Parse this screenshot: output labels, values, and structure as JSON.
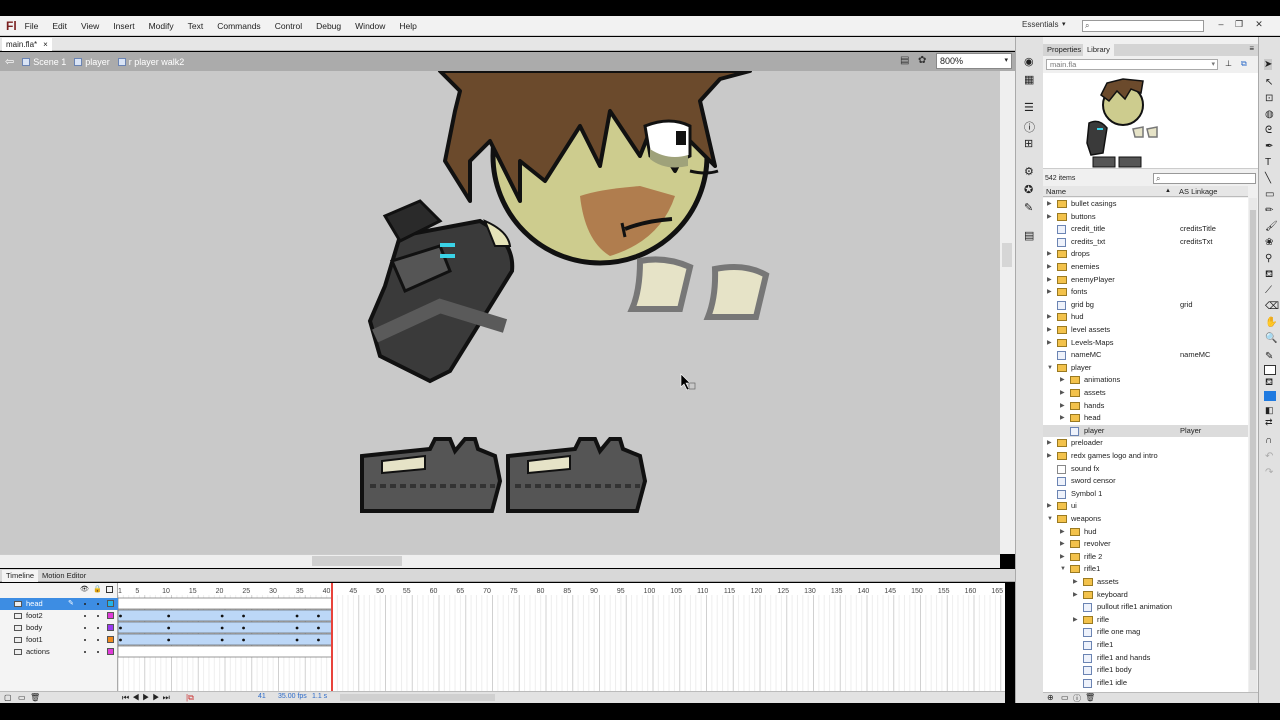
{
  "app": {
    "logo": "Fl",
    "workspace": "Essentials"
  },
  "menu": [
    "File",
    "Edit",
    "View",
    "Insert",
    "Modify",
    "Text",
    "Commands",
    "Control",
    "Debug",
    "Window",
    "Help"
  ],
  "window_buttons": [
    "–",
    "❐",
    "✕"
  ],
  "document": {
    "tab_label": "main.fla*",
    "close": "×"
  },
  "breadcrumbs": [
    "Scene 1",
    "player",
    "r player walk2"
  ],
  "zoom": "800%",
  "timeline": {
    "tabs": [
      "Timeline",
      "Motion Editor"
    ],
    "frame_numbers": [
      "1",
      "5",
      "10",
      "15",
      "20",
      "25",
      "30",
      "35",
      "40",
      "45",
      "50",
      "55",
      "60",
      "65",
      "70",
      "75",
      "80",
      "85",
      "90",
      "95",
      "100",
      "105",
      "110",
      "115",
      "120",
      "125",
      "130",
      "135",
      "140",
      "145",
      "150",
      "155",
      "160",
      "165"
    ],
    "layers": [
      {
        "name": "head",
        "color": "#22b3ea",
        "selected": true
      },
      {
        "name": "foot2",
        "color": "#e03ad8",
        "selected": false
      },
      {
        "name": "body",
        "color": "#9a3af0",
        "selected": false
      },
      {
        "name": "foot1",
        "color": "#f08a1d",
        "selected": false
      },
      {
        "name": "actions",
        "color": "#e03ad8",
        "selected": false
      }
    ],
    "current_frame": "41",
    "fps": "35.00 fps",
    "elapsed": "1.1 s"
  },
  "panel_tabs": [
    "Properties",
    "Library"
  ],
  "library": {
    "document": "main.fla",
    "item_count": "542 items",
    "columns": {
      "name": "Name",
      "linkage": "AS Linkage"
    },
    "items": [
      {
        "name": "bullet casings",
        "type": "folder",
        "indent": 0,
        "expanded": false,
        "linkage": ""
      },
      {
        "name": "buttons",
        "type": "folder",
        "indent": 0,
        "expanded": false,
        "linkage": ""
      },
      {
        "name": "credit_title",
        "type": "symbol",
        "indent": 0,
        "expanded": null,
        "linkage": "creditsTitle"
      },
      {
        "name": "credits_txt",
        "type": "symbol",
        "indent": 0,
        "expanded": null,
        "linkage": "creditsTxt"
      },
      {
        "name": "drops",
        "type": "folder",
        "indent": 0,
        "expanded": false,
        "linkage": ""
      },
      {
        "name": "enemies",
        "type": "folder",
        "indent": 0,
        "expanded": false,
        "linkage": ""
      },
      {
        "name": "enemyPlayer",
        "type": "folder",
        "indent": 0,
        "expanded": false,
        "linkage": ""
      },
      {
        "name": "fonts",
        "type": "folder",
        "indent": 0,
        "expanded": false,
        "linkage": ""
      },
      {
        "name": "grid bg",
        "type": "symbol",
        "indent": 0,
        "expanded": null,
        "linkage": "grid"
      },
      {
        "name": "hud",
        "type": "folder",
        "indent": 0,
        "expanded": false,
        "linkage": ""
      },
      {
        "name": "level assets",
        "type": "folder",
        "indent": 0,
        "expanded": false,
        "linkage": ""
      },
      {
        "name": "Levels-Maps",
        "type": "folder",
        "indent": 0,
        "expanded": false,
        "linkage": ""
      },
      {
        "name": "nameMC",
        "type": "symbol",
        "indent": 0,
        "expanded": null,
        "linkage": "nameMC"
      },
      {
        "name": "player",
        "type": "folder",
        "indent": 0,
        "expanded": true,
        "linkage": ""
      },
      {
        "name": "animations",
        "type": "folder",
        "indent": 1,
        "expanded": false,
        "linkage": ""
      },
      {
        "name": "assets",
        "type": "folder",
        "indent": 1,
        "expanded": false,
        "linkage": ""
      },
      {
        "name": "hands",
        "type": "folder",
        "indent": 1,
        "expanded": false,
        "linkage": ""
      },
      {
        "name": "head",
        "type": "folder",
        "indent": 1,
        "expanded": false,
        "linkage": ""
      },
      {
        "name": "player",
        "type": "symbol",
        "indent": 1,
        "expanded": null,
        "linkage": "Player",
        "selected": true
      },
      {
        "name": "preloader",
        "type": "folder",
        "indent": 0,
        "expanded": false,
        "linkage": ""
      },
      {
        "name": "redx games logo and intro",
        "type": "folder",
        "indent": 0,
        "expanded": false,
        "linkage": ""
      },
      {
        "name": "sound fx",
        "type": "sound",
        "indent": 0,
        "expanded": null,
        "linkage": ""
      },
      {
        "name": "sword censor",
        "type": "symbol",
        "indent": 0,
        "expanded": null,
        "linkage": ""
      },
      {
        "name": "Symbol 1",
        "type": "symbol",
        "indent": 0,
        "expanded": null,
        "linkage": ""
      },
      {
        "name": "ui",
        "type": "folder",
        "indent": 0,
        "expanded": false,
        "linkage": ""
      },
      {
        "name": "weapons",
        "type": "folder",
        "indent": 0,
        "expanded": true,
        "linkage": ""
      },
      {
        "name": "hud",
        "type": "folder",
        "indent": 1,
        "expanded": false,
        "linkage": ""
      },
      {
        "name": "revolver",
        "type": "folder",
        "indent": 1,
        "expanded": false,
        "linkage": ""
      },
      {
        "name": "rifle 2",
        "type": "folder",
        "indent": 1,
        "expanded": false,
        "linkage": ""
      },
      {
        "name": "rifle1",
        "type": "folder",
        "indent": 1,
        "expanded": true,
        "linkage": ""
      },
      {
        "name": "assets",
        "type": "folder",
        "indent": 2,
        "expanded": false,
        "linkage": ""
      },
      {
        "name": "keyboard",
        "type": "folder",
        "indent": 2,
        "expanded": false,
        "linkage": ""
      },
      {
        "name": "pullout rifle1 animation",
        "type": "symbol",
        "indent": 2,
        "expanded": null,
        "linkage": ""
      },
      {
        "name": "rifle",
        "type": "folder",
        "indent": 2,
        "expanded": false,
        "linkage": ""
      },
      {
        "name": "rifle one mag",
        "type": "symbol",
        "indent": 2,
        "expanded": null,
        "linkage": ""
      },
      {
        "name": "rifle1",
        "type": "symbol",
        "indent": 2,
        "expanded": null,
        "linkage": ""
      },
      {
        "name": "rifle1 and hands",
        "type": "symbol",
        "indent": 2,
        "expanded": null,
        "linkage": ""
      },
      {
        "name": "rifle1 body",
        "type": "symbol",
        "indent": 2,
        "expanded": null,
        "linkage": ""
      },
      {
        "name": "rifle1 idle",
        "type": "symbol",
        "indent": 2,
        "expanded": null,
        "linkage": ""
      }
    ]
  },
  "colors": {
    "accent": "#1f7ae0",
    "stage": "#c9c9c9",
    "layer_selected": "#3d8de3",
    "frame_span": "#bcd7f7",
    "playhead": "#e8433b"
  }
}
